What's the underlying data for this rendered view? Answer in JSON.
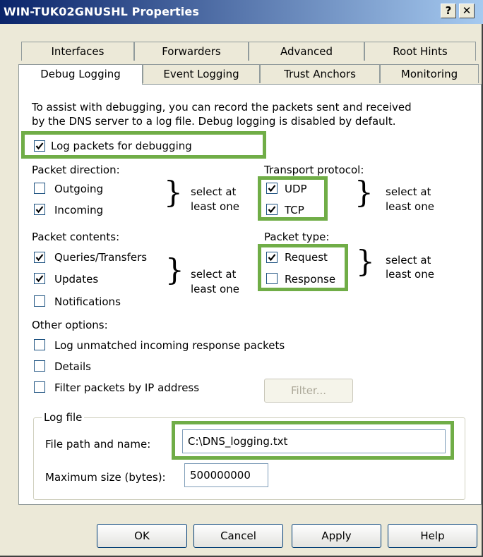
{
  "window": {
    "title": "WIN-TUK02GNUSHL Properties",
    "help_glyph": "?",
    "close_glyph": "✕"
  },
  "tabs_row1": [
    "Interfaces",
    "Forwarders",
    "Advanced",
    "Root Hints"
  ],
  "tabs_row2": [
    "Debug Logging",
    "Event Logging",
    "Trust Anchors",
    "Monitoring"
  ],
  "panel": {
    "description_line1": "To assist with debugging, you can record the packets sent and received",
    "description_line2": "by the DNS server to a log file. Debug logging is disabled by default.",
    "log_packets": {
      "label": "Log packets for debugging",
      "checked": true
    },
    "packet_direction": {
      "heading": "Packet direction:",
      "outgoing": {
        "label": "Outgoing",
        "checked": false
      },
      "incoming": {
        "label": "Incoming",
        "checked": true
      },
      "hint_line1": "select at",
      "hint_line2": "least one"
    },
    "transport_protocol": {
      "heading": "Transport protocol:",
      "udp": {
        "label": "UDP",
        "checked": true
      },
      "tcp": {
        "label": "TCP",
        "checked": true
      },
      "hint_line1": "select at",
      "hint_line2": "least one"
    },
    "packet_contents": {
      "heading": "Packet contents:",
      "queries": {
        "label": "Queries/Transfers",
        "checked": true
      },
      "updates": {
        "label": "Updates",
        "checked": true
      },
      "notifications": {
        "label": "Notifications",
        "checked": false
      },
      "hint_line1": "select at",
      "hint_line2": "least one"
    },
    "packet_type": {
      "heading": "Packet type:",
      "request": {
        "label": "Request",
        "checked": true
      },
      "response": {
        "label": "Response",
        "checked": false
      },
      "hint_line1": "select at",
      "hint_line2": "least one"
    },
    "other_options": {
      "heading": "Other options:",
      "unmatched": {
        "label": "Log unmatched incoming response packets",
        "checked": false
      },
      "details": {
        "label": "Details",
        "checked": false
      },
      "filter_ip": {
        "label": "Filter packets by IP address",
        "checked": false
      },
      "filter_button": "Filter..."
    },
    "log_file": {
      "legend": "Log file",
      "path_label": "File path and name:",
      "path_value": "C:\\DNS_logging.txt",
      "size_label": "Maximum size (bytes):",
      "size_value": "500000000"
    }
  },
  "buttons": {
    "ok": "OK",
    "cancel": "Cancel",
    "apply": "Apply",
    "help": "Help"
  },
  "colors": {
    "highlight": "#70ad47",
    "dialog_bg": "#ece9d8",
    "title_start": "#0a246a"
  }
}
